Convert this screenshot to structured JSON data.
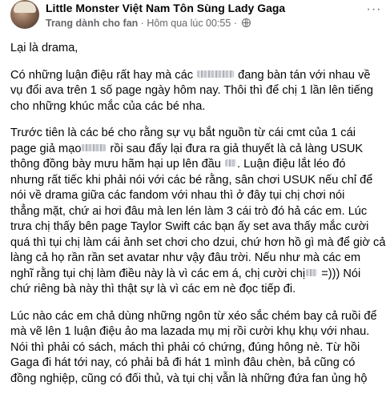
{
  "header": {
    "page_name": "Little Monster Việt Nam Tôn Sùng Lady Gaga",
    "role": "Trang dành cho fan",
    "separator": " · ",
    "time": "Hôm qua lúc 00:55",
    "time_sep": " · ",
    "audience_icon": "globe-icon",
    "more_label": "···"
  },
  "post": {
    "p1": "Lại là drama,",
    "p2_l1a": "Có những luận điệu rất hay mà các",
    "p2_l1b": "đang bàn tán với nhau về",
    "p2_l2": "vụ đổi ava trên 1 số page ngày hôm nay. Thôi thì để chị 1 lần lên tiếng",
    "p2_l3": "cho những khúc mắc của các bé nha.",
    "p3_l1": "Trước tiên là các bé cho rằng sự vụ bắt nguồn từ cái cmt của 1 cái",
    "p3_l2a": "page giả mạo",
    "p3_l2b": "rồi sau đấy lại đưa ra giả thuyết là cả làng USUK",
    "p3_l3a": "thông đồng bày mưu hãm hại up lên đầu",
    "p3_l3b": ". Luận điệu lắt léo đó",
    "p3_l4": "nhưng rất tiếc khi phải nói với các bé rằng, sân chơi USUK nếu chỉ để",
    "p3_l5": "nói về drama giữa các fandom với nhau thì ở đây tụi chị chơi nói",
    "p3_l6": "thẳng mặt, chứ ai hơi đâu mà len lén làm 3 cái trò đó hả các em. Lúc",
    "p3_l7": "trưa chị thấy bên page Taylor Swift các bạn ấy set ava thấy mắc cười",
    "p3_l8": "quá thì tụi chị làm cái ảnh set chơi cho dzui, chứ hơn hồ gì mà để giờ cả",
    "p3_l9": "làng cả họ rần rần set avatar như vậy đâu trời. Nếu như mà các em",
    "p3_l10a": "nghĩ rằng tụi chị làm điều này là vì các em á, chị cười chị",
    "p3_l10b": "=))) Nói",
    "p3_l11": "chứ riêng bà này thì thật sự là vì các em nè đọc tiếp đi.",
    "p4_l1": "Lúc nào các em chả dùng những ngôn từ xéo sắc chém bay cả ruồi để",
    "p4_l2": "mà vẽ lên 1 luận điệu ảo ma lazada mụ mị rồi cười khụ khụ với nhau.",
    "p4_l3": "Nói thì phải có sách, mách thì phải có chứng, đúng hông nè. Từ hồi",
    "p4_l4": "Gaga đi hát tới nay, có phải bả đi hát 1 mình đâu chèn, bả cũng có",
    "p4_l5": "đồng nghiệp, cũng có đối thủ, và tụi chị vẫn là những đứa fan ủng hộ"
  }
}
